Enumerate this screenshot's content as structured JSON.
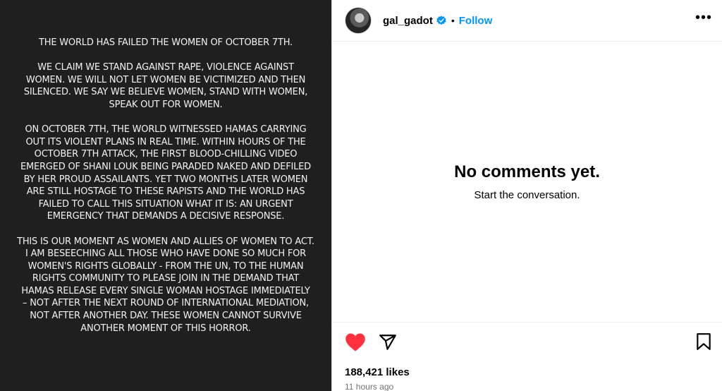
{
  "post_text": {
    "paragraphs": [
      "THE WORLD HAS FAILED THE WOMEN OF OCTOBER 7TH.",
      "WE CLAIM WE STAND AGAINST RAPE, VIOLENCE AGAINST\nWOMEN. WE WILL NOT LET WOMEN BE VICTIMIZED AND THEN\nSILENCED. WE SAY WE BELIEVE WOMEN, STAND WITH WOMEN,\nSPEAK OUT FOR WOMEN.",
      "ON OCTOBER 7TH, THE WORLD WITNESSED HAMAS CARRYING\nOUT ITS VIOLENT PLANS IN REAL TIME. WITHIN HOURS OF THE\nOCTOBER 7TH ATTACK, THE FIRST BLOOD-CHILLING VIDEO\nEMERGED OF SHANI LOUK BEING PARADED NAKED AND DEFILED\nBY HER PROUD ASSAILANTS. YET TWO MONTHS LATER WOMEN\nARE STILL HOSTAGE TO THESE RAPISTS AND THE WORLD HAS\nFAILED TO CALL THIS SITUATION WHAT IT IS: AN URGENT\nEMERGENCY THAT DEMANDS A DECISIVE RESPONSE.",
      "THIS IS OUR MOMENT AS WOMEN AND ALLIES OF WOMEN TO ACT.\nI AM BESEECHING ALL THOSE WHO HAVE DONE SO MUCH FOR\nWOMEN'S RIGHTS GLOBALLY - FROM THE UN, TO THE HUMAN\nRIGHTS COMMUNITY TO PLEASE JOIN IN THE DEMAND THAT\nHAMAS RELEASE EVERY SINGLE WOMAN HOSTAGE IMMEDIATELY\n– NOT AFTER THE NEXT ROUND OF INTERNATIONAL MEDIATION,\nNOT AFTER ANOTHER DAY. THESE WOMEN CANNOT SURVIVE\nANOTHER MOMENT OF THIS HORROR."
    ]
  },
  "header": {
    "username": "gal_gadot",
    "separator": "•",
    "follow_label": "Follow",
    "more_label": "•••"
  },
  "comments": {
    "empty_title": "No comments yet.",
    "empty_subtitle": "Start the conversation."
  },
  "actions": {
    "likes": "188,421 likes",
    "time_ago": "11 hours ago"
  },
  "colors": {
    "accent": "#0095f6",
    "heart": "#ff3040",
    "image_background": "#1f1f1f",
    "muted_text": "#737373"
  },
  "icons": [
    "verified-badge-icon",
    "heart-icon",
    "send-icon",
    "bookmark-icon",
    "more-options-icon"
  ]
}
